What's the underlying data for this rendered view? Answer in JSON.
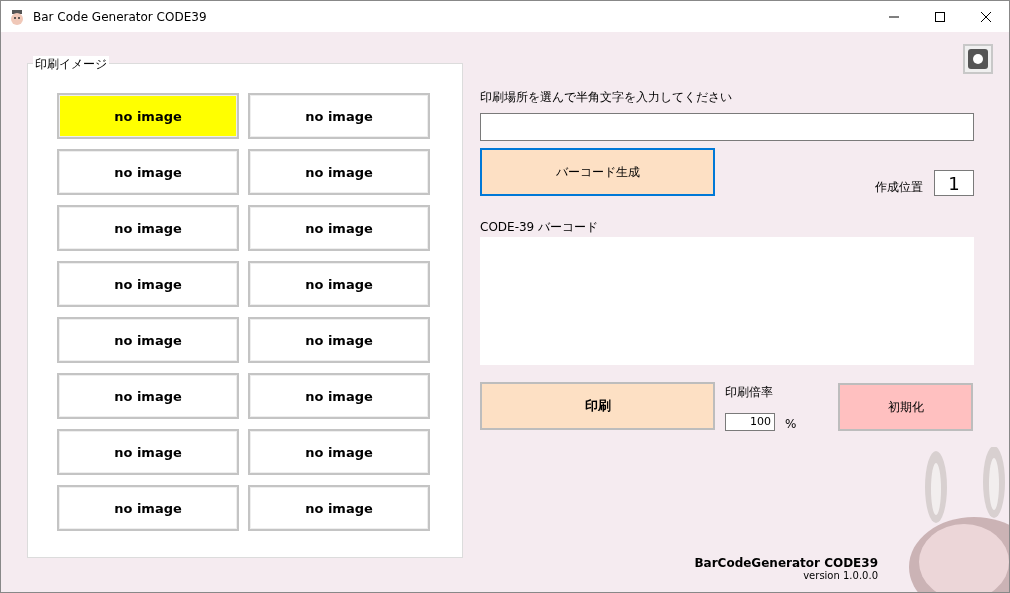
{
  "window": {
    "title": "Bar Code Generator CODE39"
  },
  "print_preview": {
    "title": "印刷イメージ",
    "cells": [
      {
        "label": "no image",
        "selected": true
      },
      {
        "label": "no image",
        "selected": false
      },
      {
        "label": "no image",
        "selected": false
      },
      {
        "label": "no image",
        "selected": false
      },
      {
        "label": "no image",
        "selected": false
      },
      {
        "label": "no image",
        "selected": false
      },
      {
        "label": "no image",
        "selected": false
      },
      {
        "label": "no image",
        "selected": false
      },
      {
        "label": "no image",
        "selected": false
      },
      {
        "label": "no image",
        "selected": false
      },
      {
        "label": "no image",
        "selected": false
      },
      {
        "label": "no image",
        "selected": false
      },
      {
        "label": "no image",
        "selected": false
      },
      {
        "label": "no image",
        "selected": false
      },
      {
        "label": "no image",
        "selected": false
      },
      {
        "label": "no image",
        "selected": false
      }
    ]
  },
  "input_label": "印刷場所を選んで半角文字を入力してください",
  "generate_button": "バーコード生成",
  "position": {
    "label": "作成位置",
    "value": "1"
  },
  "barcode_label": "CODE-39 バーコード",
  "print_button": "印刷",
  "scale": {
    "label": "印刷倍率",
    "value": "100",
    "unit": "%"
  },
  "reset_button": "初期化",
  "footer": {
    "name": "BarCodeGenerator CODE39",
    "version": "version 1.0.0.0"
  }
}
